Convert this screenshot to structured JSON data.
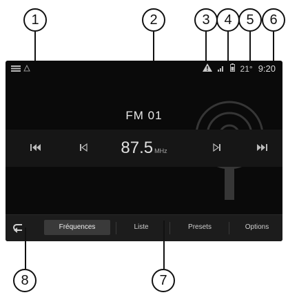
{
  "callouts": [
    "1",
    "2",
    "3",
    "4",
    "5",
    "6",
    "7",
    "8"
  ],
  "status": {
    "time": "9:20",
    "temperature": "21°"
  },
  "radio": {
    "station": "FM 01",
    "frequency": "87.5",
    "unit": "MHz"
  },
  "controls": {
    "seek_back_icon": "double-chevron-left-icon",
    "step_back_icon": "chevron-left-icon",
    "step_forward_icon": "chevron-right-icon",
    "seek_forward_icon": "double-chevron-right-icon"
  },
  "tabs": [
    "Fréquences",
    "Liste",
    "Presets",
    "Options"
  ],
  "colors": {
    "screen_bg": "#0a0a0a",
    "tab_active": "#3a3a3a",
    "warning_icon": "#c9c9c9"
  }
}
